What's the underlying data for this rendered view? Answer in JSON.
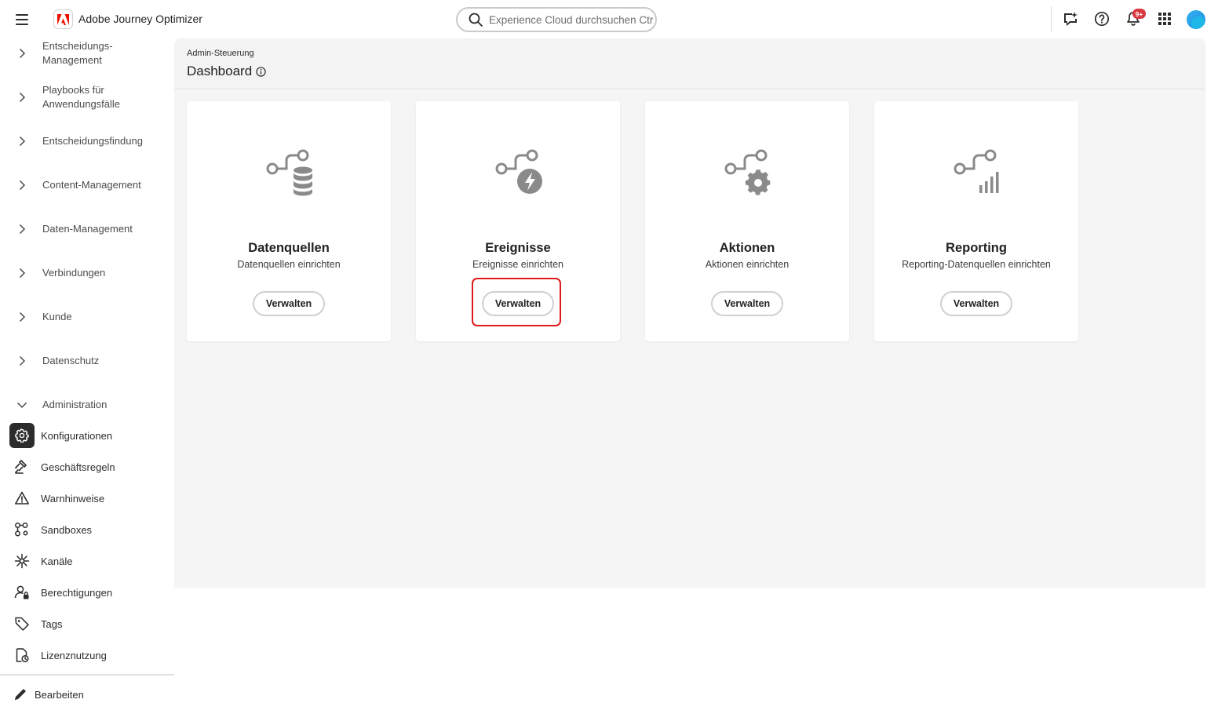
{
  "app": {
    "title": "Adobe Journey Optimizer"
  },
  "search": {
    "placeholder": "Experience Cloud durchsuchen Ctr..."
  },
  "notifications": {
    "badge": "9+"
  },
  "sidebar": {
    "groups": [
      {
        "label": "Entscheidungs-\nManagement"
      },
      {
        "label": "Playbooks für\nAnwendungsfälle"
      },
      {
        "label": "Entscheidungsfindung"
      },
      {
        "label": "Content-Management"
      },
      {
        "label": "Daten-Management"
      },
      {
        "label": "Verbindungen"
      },
      {
        "label": "Kunde"
      },
      {
        "label": "Datenschutz"
      },
      {
        "label": "Administration"
      }
    ],
    "items": [
      {
        "label": "Konfigurationen",
        "icon": "gear-icon"
      },
      {
        "label": "Geschäftsregeln",
        "icon": "gavel-icon"
      },
      {
        "label": "Warnhinweise",
        "icon": "alert-icon"
      },
      {
        "label": "Sandboxes",
        "icon": "sandbox-icon"
      },
      {
        "label": "Kanäle",
        "icon": "channels-icon"
      },
      {
        "label": "Berechtigungen",
        "icon": "permissions-icon"
      },
      {
        "label": "Tags",
        "icon": "tag-icon"
      },
      {
        "label": "Lizenznutzung",
        "icon": "license-icon"
      }
    ],
    "edit_label": "Bearbeiten"
  },
  "main": {
    "breadcrumb": "Admin-Steuerung",
    "title": "Dashboard",
    "cards": [
      {
        "title": "Datenquellen",
        "description": "Datenquellen einrichten",
        "button": "Verwalten",
        "icon": "datasource-icon"
      },
      {
        "title": "Ereignisse",
        "description": "Ereignisse einrichten",
        "button": "Verwalten",
        "icon": "events-icon"
      },
      {
        "title": "Aktionen",
        "description": "Aktionen einrichten",
        "button": "Verwalten",
        "icon": "actions-icon"
      },
      {
        "title": "Reporting",
        "description": "Reporting-Datenquellen einrichten",
        "button": "Verwalten",
        "icon": "reporting-icon"
      }
    ]
  },
  "colors": {
    "accent_highlight": "#e01a1a",
    "active_nav_bg": "#2c2c2c",
    "badge": "#d7373f",
    "adobe_red": "#eb1000"
  }
}
